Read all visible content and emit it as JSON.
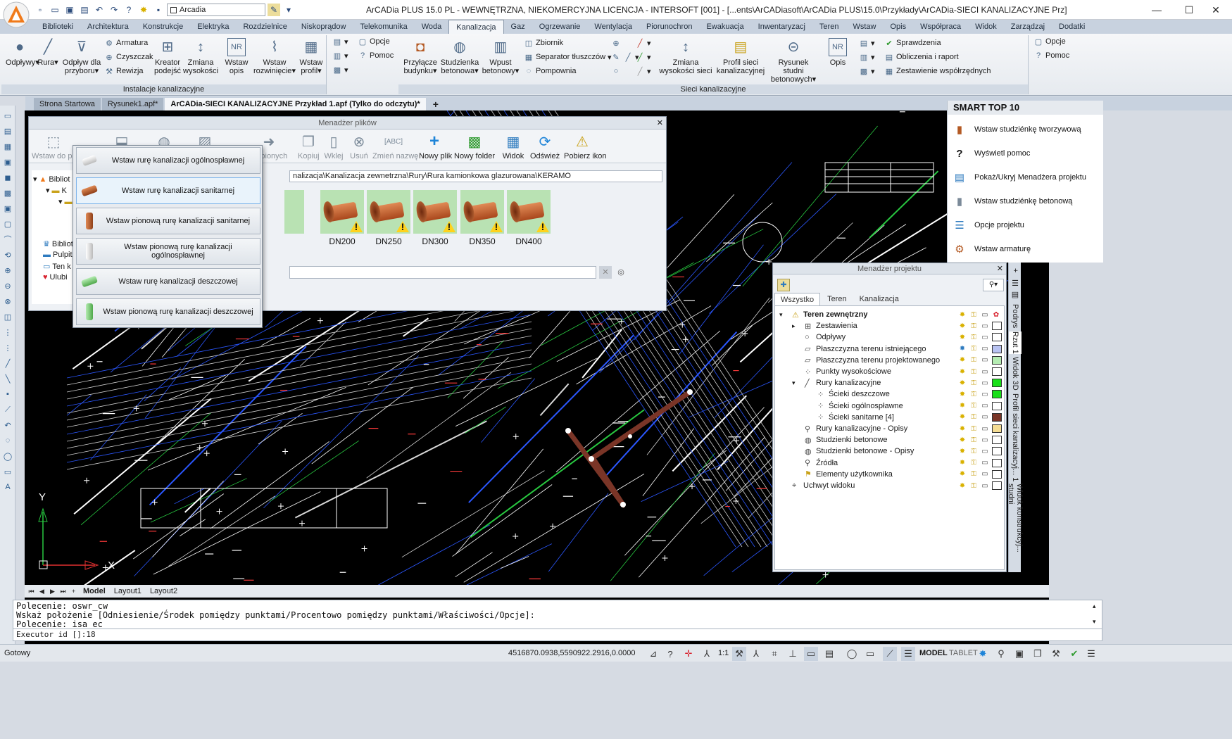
{
  "window": {
    "title": "ArCADia PLUS 15.0 PL - WEWNĘTRZNA, NIEKOMERCYJNA LICENCJA - INTERSOFT [001] - [...ents\\ArCADiasoft\\ArCADia PLUS\\15.0\\Przykłady\\ArCADia-SIECI KANALIZACYJNE Prz]",
    "layer_combo": "Arcadia"
  },
  "ribbon_tabs": [
    "Biblioteki",
    "Architektura",
    "Konstrukcje",
    "Elektryka",
    "Rozdzielnice",
    "Niskoprądowe",
    "Telekomunikacja",
    "Woda",
    "Kanalizacja",
    "Gaz",
    "Ogrzewanie",
    "Wentylacja",
    "Piorunochron",
    "Ewakuacja",
    "Inwentaryzacja",
    "Teren",
    "Wstaw",
    "Opis",
    "Współpraca",
    "Widok",
    "Zarządzaj",
    "Dodatki"
  ],
  "ribbon_tabs_display": [
    "Biblioteki",
    "Architektura",
    "Konstrukcje",
    "Elektryka",
    "Rozdzielnice",
    "Niskoprądow",
    "Telekomunika",
    "Woda",
    "Kanalizacja",
    "Gaz",
    "Ogrzewanie",
    "Wentylacja",
    "Piorunochron",
    "Ewakuacja",
    "Inwentaryzacj",
    "Teren",
    "Wstaw",
    "Opis",
    "Współpraca",
    "Widok",
    "Zarządzaj",
    "Dodatki"
  ],
  "ribbon": {
    "group1": {
      "label": "Instalacje kanalizacyjne",
      "odplywy": "Odpływy",
      "rura": "Rura",
      "odplyw_przyboru_1": "Odpływ dla",
      "odplyw_przyboru_2": "przyboru",
      "armatura": "Armatura",
      "czyszczak": "Czyszczak",
      "rewizja": "Rewizja",
      "kreator_1": "Kreator",
      "kreator_2": "podejść",
      "zmiana_1": "Zmiana",
      "zmiana_2": "wysokości",
      "wstaw_opis_1": "Wstaw",
      "wstaw_opis_2": "opis",
      "wstaw_rozw_1": "Wstaw",
      "wstaw_rozw_2": "rozwinięcie",
      "wstaw_profil_1": "Wstaw",
      "wstaw_profil_2": "profil",
      "opcje": "Opcje",
      "pomoc": "Pomoc"
    },
    "group2": {
      "label": "Sieci kanalizacyjne",
      "przylacze_1": "Przyłącze",
      "przylacze_2": "budynku",
      "studzienka_1": "Studzienka",
      "studzienka_2": "betonowa",
      "wpust_1": "Wpust",
      "wpust_2": "betonowy",
      "zbiornik": "Zbiornik",
      "separator": "Separator tłuszczów",
      "pompownia": "Pompownia",
      "zmiana_1": "Zmiana",
      "zmiana_2": "wysokości sieci",
      "profil_1": "Profil sieci",
      "profil_2": "kanalizacyjnej",
      "rysunek_1": "Rysunek studni",
      "rysunek_2": "betonowych",
      "opis": "Opis",
      "sprawdzenia": "Sprawdzenia",
      "obliczenia": "Obliczenia i raport",
      "zestawienie": "Zestawienie współrzędnych",
      "opcje": "Opcje",
      "pomoc": "Pomoc"
    }
  },
  "doc_tabs": [
    "Strona Startowa",
    "Rysunek1.apf*",
    "ArCADia-SIECI KANALIZACYJNE Przykład 1.apf (Tylko do odczytu)*"
  ],
  "file_manager": {
    "title": "Menadżer plików",
    "buttons": {
      "wstaw": "Wstaw do pro",
      "ulubionych": "ulubionych",
      "kopiuj": "Kopiuj",
      "wklej": "Wklej",
      "usun": "Usuń",
      "zmien": "Zmień nazwę",
      "nowy_plik": "Nowy plik",
      "nowy_folder": "Nowy folder",
      "widok": "Widok",
      "odswiez": "Odśwież",
      "pobierz": "Pobierz ikon"
    },
    "path": "nalizacja\\Kanalizacja zewnetrzna\\Rury\\Rura kamionkowa glazurowana\\KERAMO",
    "tree": [
      "Bibliot",
      "Biblioteki",
      "Pulpit",
      "Ten k",
      "Ulubi"
    ],
    "pipes": [
      "DN200",
      "DN250",
      "DN300",
      "DN350",
      "DN400"
    ]
  },
  "dropdown_menu": {
    "items": [
      "Wstaw rurę kanalizacji ogólnospławnej",
      "Wstaw rurę kanalizacji sanitarnej",
      "Wstaw pionową rurę kanalizacji sanitarnej",
      "Wstaw pionową rurę kanalizacji ogólnospławnej",
      "Wstaw rurę kanalizacji deszczowej",
      "Wstaw pionową rurę kanalizacji deszczowej"
    ]
  },
  "smart_top": {
    "title": "SMART TOP 10",
    "items": [
      "Wstaw studziénkę tworzywową",
      "Wyświetl pomoc",
      "Pokaż/Ukryj Menadżera projektu",
      "Wstaw studziénkę betonową",
      "Opcje projektu",
      "Wstaw armaturę"
    ]
  },
  "project_manager": {
    "title": "Menadżer projektu",
    "tabs": [
      "Wszystko",
      "Teren",
      "Kanalizacja"
    ],
    "rows": [
      {
        "label": "Teren zewnętrzny",
        "indent": 0,
        "color": ""
      },
      {
        "label": "Zestawienia",
        "indent": 1,
        "color": "#ffffff"
      },
      {
        "label": "Odpływy",
        "indent": 1,
        "color": "#ffffff"
      },
      {
        "label": "Płaszczyzna terenu istniejącego",
        "indent": 1,
        "color": "#b9c3f2"
      },
      {
        "label": "Płaszczyzna terenu projektowanego",
        "indent": 1,
        "color": "#b5ecb2"
      },
      {
        "label": "Punkty wysokościowe",
        "indent": 1,
        "color": "#ffffff"
      },
      {
        "label": "Rury kanalizacyjne",
        "indent": 1,
        "color": "#18e018"
      },
      {
        "label": "Ścieki deszczowe",
        "indent": 2,
        "color": "#18e018"
      },
      {
        "label": "Ścieki ogólnospławne",
        "indent": 2,
        "color": "#ffffff"
      },
      {
        "label": "Ścieki sanitarne [4]",
        "indent": 2,
        "color": "#7a3527"
      },
      {
        "label": "Rury kanalizacyjne - Opisy",
        "indent": 1,
        "color": "#f5dd93"
      },
      {
        "label": "Studzienki betonowe",
        "indent": 1,
        "color": "#ffffff"
      },
      {
        "label": "Studzienki betonowe - Opisy",
        "indent": 1,
        "color": "#ffffff"
      },
      {
        "label": "Źródła",
        "indent": 1,
        "color": "#ffffff"
      },
      {
        "label": "Elementy użytkownika",
        "indent": 1,
        "color": "#ffffff"
      },
      {
        "label": "Uchwyt widoku",
        "indent": 0,
        "color": "#ffffff"
      }
    ]
  },
  "side_tabs": [
    "Podrys",
    "Rzut 1",
    "Widok 3D",
    "Profil sieci kanalizacyj... 1",
    "Widok konstrukcyj... studni"
  ],
  "layout_tabs": [
    "Model",
    "Layout1",
    "Layout2"
  ],
  "drawing": {
    "axis_y": "Y",
    "axis_x": "X"
  },
  "command_line": {
    "lines": [
      "Polecenie: oswr_cw",
      "Wskaż położenie [Odniesienie/Środek pomiędzy punktami/Procentowo pomiędzy punktami/Właściwości/Opcje]:",
      "Polecenie: isa_ec"
    ],
    "executor": "Executor id []:18"
  },
  "status": {
    "ready": "Gotowy",
    "coords": "4516870.0938,5590922.2916,0.0000",
    "scale": "1:1",
    "model": "MODEL",
    "tablet": "TABLET"
  }
}
